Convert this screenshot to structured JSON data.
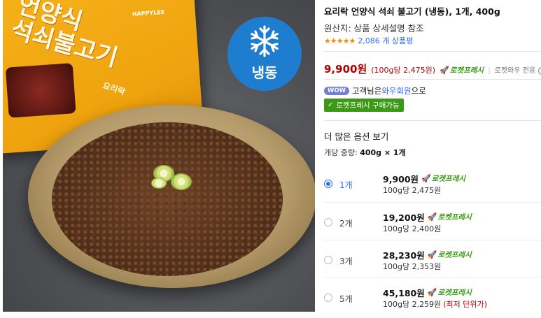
{
  "product_image": {
    "package_text": "언양식\n석쇠불고기",
    "package_sub": "요리락",
    "package_brand": "HAPPYLEE",
    "freeze_badge": {
      "icon": "snowflake-icon",
      "label": "냉동",
      "color": "#1f7dd0"
    }
  },
  "product": {
    "title": "요리락 언양식 석쇠 불고기 (냉동), 1개, 400g",
    "origin": "원산지: 상품 상세설명 참조",
    "rating": {
      "stars": 4.5,
      "stars_display": "★★★★★",
      "review_count": "2,086 개 상품평"
    }
  },
  "price": {
    "sale_price": "9,900원",
    "unit_price": "(100g당 2,475원)",
    "rocket_label": "로켓프레시",
    "wow_only": "로켓와우 전용",
    "info_icon": "info-icon"
  },
  "wow": {
    "pill": "WOW",
    "text_before": "고객님은 ",
    "member_link": "와우회원",
    "text_after": "으로",
    "fresh_available": "로켓프레시 구매가능"
  },
  "options": {
    "heading": "더 많은 옵션 보기",
    "unit_weight_label": "개당 중량:",
    "unit_weight_value": "400g × 1개",
    "items": [
      {
        "qty": "1개",
        "price": "9,900원",
        "badge": "로켓프레시",
        "per": "100g당 2,475원",
        "note": "",
        "selected": true
      },
      {
        "qty": "2개",
        "price": "19,200원",
        "badge": "로켓프레시",
        "per": "100g당 2,400원",
        "note": "",
        "selected": false
      },
      {
        "qty": "3개",
        "price": "28,230원",
        "badge": "로켓프레시",
        "per": "100g당 2,353원",
        "note": "",
        "selected": false
      },
      {
        "qty": "5개",
        "price": "45,180원",
        "badge": "로켓프레시",
        "per": "100g당 2,259원",
        "note": "(최저 단위가)",
        "selected": false
      }
    ]
  },
  "colors": {
    "accent_blue": "#346aff",
    "price_red": "#ae0000",
    "rocket_green": "#3a9c14",
    "star_orange": "#f28c06"
  }
}
